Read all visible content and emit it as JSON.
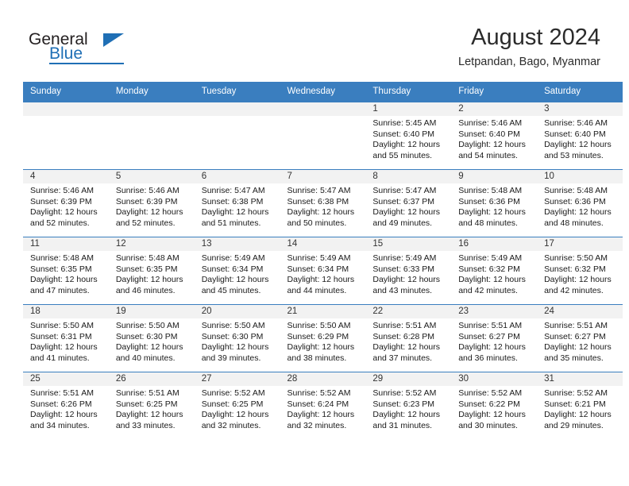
{
  "brand": {
    "name_part1": "General",
    "name_part2": "Blue",
    "accent_color": "#1f6fb5"
  },
  "header": {
    "month_title": "August 2024",
    "location": "Letpandan, Bago, Myanmar"
  },
  "calendar": {
    "header_bg": "#3a7ebf",
    "daynum_bg": "#f2f2f2",
    "weekdays": [
      "Sunday",
      "Monday",
      "Tuesday",
      "Wednesday",
      "Thursday",
      "Friday",
      "Saturday"
    ],
    "weeks": [
      [
        {
          "day": "",
          "sunrise": "",
          "sunset": "",
          "daylight1": "",
          "daylight2": ""
        },
        {
          "day": "",
          "sunrise": "",
          "sunset": "",
          "daylight1": "",
          "daylight2": ""
        },
        {
          "day": "",
          "sunrise": "",
          "sunset": "",
          "daylight1": "",
          "daylight2": ""
        },
        {
          "day": "",
          "sunrise": "",
          "sunset": "",
          "daylight1": "",
          "daylight2": ""
        },
        {
          "day": "1",
          "sunrise": "Sunrise: 5:45 AM",
          "sunset": "Sunset: 6:40 PM",
          "daylight1": "Daylight: 12 hours",
          "daylight2": "and 55 minutes."
        },
        {
          "day": "2",
          "sunrise": "Sunrise: 5:46 AM",
          "sunset": "Sunset: 6:40 PM",
          "daylight1": "Daylight: 12 hours",
          "daylight2": "and 54 minutes."
        },
        {
          "day": "3",
          "sunrise": "Sunrise: 5:46 AM",
          "sunset": "Sunset: 6:40 PM",
          "daylight1": "Daylight: 12 hours",
          "daylight2": "and 53 minutes."
        }
      ],
      [
        {
          "day": "4",
          "sunrise": "Sunrise: 5:46 AM",
          "sunset": "Sunset: 6:39 PM",
          "daylight1": "Daylight: 12 hours",
          "daylight2": "and 52 minutes."
        },
        {
          "day": "5",
          "sunrise": "Sunrise: 5:46 AM",
          "sunset": "Sunset: 6:39 PM",
          "daylight1": "Daylight: 12 hours",
          "daylight2": "and 52 minutes."
        },
        {
          "day": "6",
          "sunrise": "Sunrise: 5:47 AM",
          "sunset": "Sunset: 6:38 PM",
          "daylight1": "Daylight: 12 hours",
          "daylight2": "and 51 minutes."
        },
        {
          "day": "7",
          "sunrise": "Sunrise: 5:47 AM",
          "sunset": "Sunset: 6:38 PM",
          "daylight1": "Daylight: 12 hours",
          "daylight2": "and 50 minutes."
        },
        {
          "day": "8",
          "sunrise": "Sunrise: 5:47 AM",
          "sunset": "Sunset: 6:37 PM",
          "daylight1": "Daylight: 12 hours",
          "daylight2": "and 49 minutes."
        },
        {
          "day": "9",
          "sunrise": "Sunrise: 5:48 AM",
          "sunset": "Sunset: 6:36 PM",
          "daylight1": "Daylight: 12 hours",
          "daylight2": "and 48 minutes."
        },
        {
          "day": "10",
          "sunrise": "Sunrise: 5:48 AM",
          "sunset": "Sunset: 6:36 PM",
          "daylight1": "Daylight: 12 hours",
          "daylight2": "and 48 minutes."
        }
      ],
      [
        {
          "day": "11",
          "sunrise": "Sunrise: 5:48 AM",
          "sunset": "Sunset: 6:35 PM",
          "daylight1": "Daylight: 12 hours",
          "daylight2": "and 47 minutes."
        },
        {
          "day": "12",
          "sunrise": "Sunrise: 5:48 AM",
          "sunset": "Sunset: 6:35 PM",
          "daylight1": "Daylight: 12 hours",
          "daylight2": "and 46 minutes."
        },
        {
          "day": "13",
          "sunrise": "Sunrise: 5:49 AM",
          "sunset": "Sunset: 6:34 PM",
          "daylight1": "Daylight: 12 hours",
          "daylight2": "and 45 minutes."
        },
        {
          "day": "14",
          "sunrise": "Sunrise: 5:49 AM",
          "sunset": "Sunset: 6:34 PM",
          "daylight1": "Daylight: 12 hours",
          "daylight2": "and 44 minutes."
        },
        {
          "day": "15",
          "sunrise": "Sunrise: 5:49 AM",
          "sunset": "Sunset: 6:33 PM",
          "daylight1": "Daylight: 12 hours",
          "daylight2": "and 43 minutes."
        },
        {
          "day": "16",
          "sunrise": "Sunrise: 5:49 AM",
          "sunset": "Sunset: 6:32 PM",
          "daylight1": "Daylight: 12 hours",
          "daylight2": "and 42 minutes."
        },
        {
          "day": "17",
          "sunrise": "Sunrise: 5:50 AM",
          "sunset": "Sunset: 6:32 PM",
          "daylight1": "Daylight: 12 hours",
          "daylight2": "and 42 minutes."
        }
      ],
      [
        {
          "day": "18",
          "sunrise": "Sunrise: 5:50 AM",
          "sunset": "Sunset: 6:31 PM",
          "daylight1": "Daylight: 12 hours",
          "daylight2": "and 41 minutes."
        },
        {
          "day": "19",
          "sunrise": "Sunrise: 5:50 AM",
          "sunset": "Sunset: 6:30 PM",
          "daylight1": "Daylight: 12 hours",
          "daylight2": "and 40 minutes."
        },
        {
          "day": "20",
          "sunrise": "Sunrise: 5:50 AM",
          "sunset": "Sunset: 6:30 PM",
          "daylight1": "Daylight: 12 hours",
          "daylight2": "and 39 minutes."
        },
        {
          "day": "21",
          "sunrise": "Sunrise: 5:50 AM",
          "sunset": "Sunset: 6:29 PM",
          "daylight1": "Daylight: 12 hours",
          "daylight2": "and 38 minutes."
        },
        {
          "day": "22",
          "sunrise": "Sunrise: 5:51 AM",
          "sunset": "Sunset: 6:28 PM",
          "daylight1": "Daylight: 12 hours",
          "daylight2": "and 37 minutes."
        },
        {
          "day": "23",
          "sunrise": "Sunrise: 5:51 AM",
          "sunset": "Sunset: 6:27 PM",
          "daylight1": "Daylight: 12 hours",
          "daylight2": "and 36 minutes."
        },
        {
          "day": "24",
          "sunrise": "Sunrise: 5:51 AM",
          "sunset": "Sunset: 6:27 PM",
          "daylight1": "Daylight: 12 hours",
          "daylight2": "and 35 minutes."
        }
      ],
      [
        {
          "day": "25",
          "sunrise": "Sunrise: 5:51 AM",
          "sunset": "Sunset: 6:26 PM",
          "daylight1": "Daylight: 12 hours",
          "daylight2": "and 34 minutes."
        },
        {
          "day": "26",
          "sunrise": "Sunrise: 5:51 AM",
          "sunset": "Sunset: 6:25 PM",
          "daylight1": "Daylight: 12 hours",
          "daylight2": "and 33 minutes."
        },
        {
          "day": "27",
          "sunrise": "Sunrise: 5:52 AM",
          "sunset": "Sunset: 6:25 PM",
          "daylight1": "Daylight: 12 hours",
          "daylight2": "and 32 minutes."
        },
        {
          "day": "28",
          "sunrise": "Sunrise: 5:52 AM",
          "sunset": "Sunset: 6:24 PM",
          "daylight1": "Daylight: 12 hours",
          "daylight2": "and 32 minutes."
        },
        {
          "day": "29",
          "sunrise": "Sunrise: 5:52 AM",
          "sunset": "Sunset: 6:23 PM",
          "daylight1": "Daylight: 12 hours",
          "daylight2": "and 31 minutes."
        },
        {
          "day": "30",
          "sunrise": "Sunrise: 5:52 AM",
          "sunset": "Sunset: 6:22 PM",
          "daylight1": "Daylight: 12 hours",
          "daylight2": "and 30 minutes."
        },
        {
          "day": "31",
          "sunrise": "Sunrise: 5:52 AM",
          "sunset": "Sunset: 6:21 PM",
          "daylight1": "Daylight: 12 hours",
          "daylight2": "and 29 minutes."
        }
      ]
    ]
  }
}
